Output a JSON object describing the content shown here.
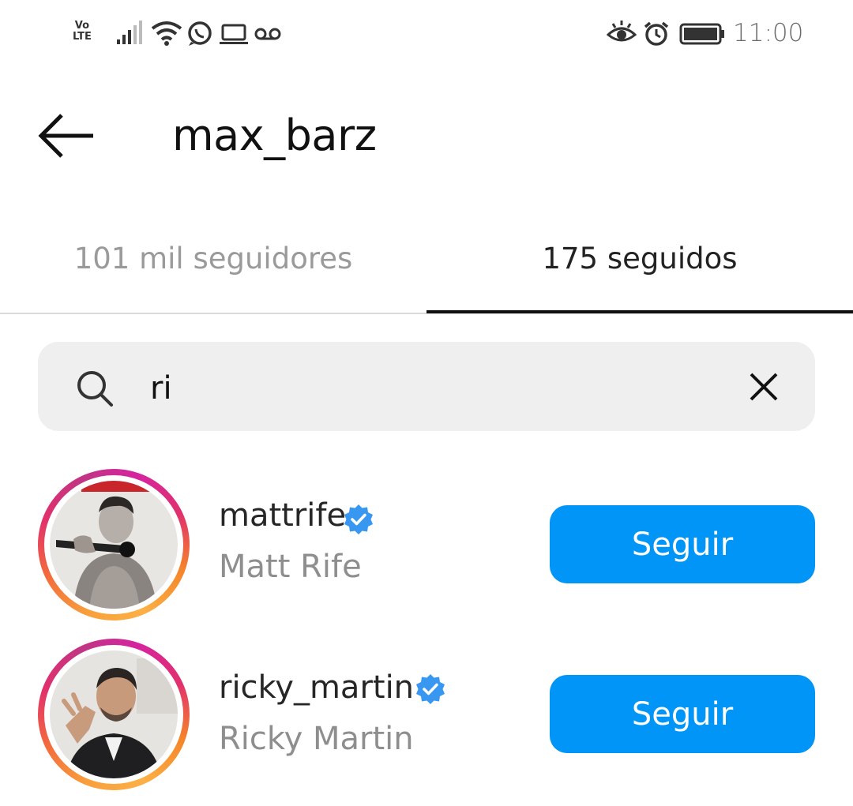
{
  "status_bar": {
    "network_label_top": "Vo",
    "network_label_bottom": "LTE",
    "time": "11:00",
    "icons": [
      "signal-icon",
      "wifi-icon",
      "whatsapp-icon",
      "laptop-icon",
      "voicemail-icon",
      "eye-comfort-icon",
      "alarm-icon",
      "battery-icon"
    ]
  },
  "header": {
    "title": "max_barz",
    "back_icon": "back-arrow-icon"
  },
  "tabs": [
    {
      "label": "101 mil seguidores",
      "active": false
    },
    {
      "label": "175 seguidos",
      "active": true
    }
  ],
  "search": {
    "value": "ri",
    "search_icon": "search-icon",
    "clear_icon": "close-icon"
  },
  "results": [
    {
      "username": "mattrife",
      "full_name": "Matt Rife",
      "verified": true,
      "button_label": "Seguir"
    },
    {
      "username": "ricky_martin",
      "full_name": "Ricky Martin",
      "verified": true,
      "button_label": "Seguir"
    }
  ],
  "colors": {
    "accent": "#0095f6",
    "verified": "#3897f0",
    "tab_active": "#111111",
    "tab_inactive": "#9a9a9a"
  }
}
